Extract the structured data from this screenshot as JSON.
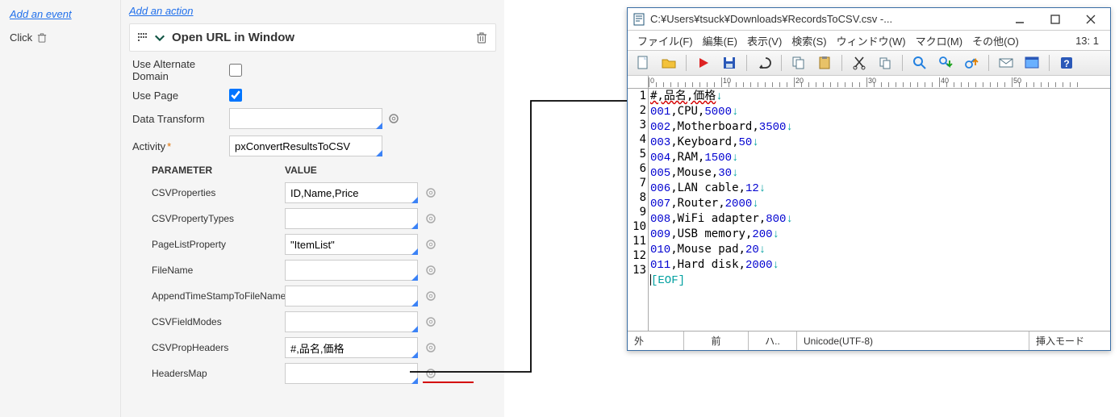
{
  "left_sidebar": {
    "add_event_label": "Add an event",
    "click_label": "Click"
  },
  "form": {
    "add_action_label": "Add an action",
    "action_title": "Open URL in Window",
    "labels": {
      "use_alt_domain": "Use Alternate Domain",
      "use_page": "Use Page",
      "data_transform": "Data Transform",
      "activity": "Activity"
    },
    "checks": {
      "use_alt_domain": false,
      "use_page": true
    },
    "values": {
      "data_transform": "",
      "activity": "pxConvertResultsToCSV"
    },
    "params_header": {
      "parameter": "PARAMETER",
      "value": "VALUE"
    },
    "params": [
      {
        "name": "CSVProperties",
        "value": "ID,Name,Price"
      },
      {
        "name": "CSVPropertyTypes",
        "value": ""
      },
      {
        "name": "PageListProperty",
        "value": "\"ItemList\""
      },
      {
        "name": "FileName",
        "value": ""
      },
      {
        "name": "AppendTimeStampToFileName",
        "value": ""
      },
      {
        "name": "CSVFieldModes",
        "value": ""
      },
      {
        "name": "CSVPropHeaders",
        "value": "#,品名,価格"
      },
      {
        "name": "HeadersMap",
        "value": ""
      }
    ]
  },
  "editor": {
    "title": "C:¥Users¥tsuck¥Downloads¥RecordsToCSV.csv  -...",
    "menus": [
      "ファイル(F)",
      "編集(E)",
      "表示(V)",
      "検索(S)",
      "ウィンドウ(W)",
      "マクロ(M)",
      "その他(O)"
    ],
    "cursor_pos": "13: 1",
    "lines": [
      {
        "n": 1,
        "text": "#,品名,価格",
        "kind": "header"
      },
      {
        "n": 2,
        "a": "001,CPU,",
        "b": "5000"
      },
      {
        "n": 3,
        "a": "002,Motherboard,",
        "b": "3500"
      },
      {
        "n": 4,
        "a": "003,Keyboard,",
        "b": "50"
      },
      {
        "n": 5,
        "a": "004,RAM,",
        "b": "1500"
      },
      {
        "n": 6,
        "a": "005,Mouse,",
        "b": "30"
      },
      {
        "n": 7,
        "a": "006,LAN cable,",
        "b": "12"
      },
      {
        "n": 8,
        "a": "007,Router,",
        "b": "2000"
      },
      {
        "n": 9,
        "a": "008,WiFi adapter,",
        "b": "800"
      },
      {
        "n": 10,
        "a": "009,USB memory,",
        "b": "200"
      },
      {
        "n": 11,
        "a": "010,Mouse pad,",
        "b": "20"
      },
      {
        "n": 12,
        "a": "011,Hard disk,",
        "b": "2000"
      },
      {
        "n": 13,
        "eof": "[EOF]"
      }
    ],
    "ruler_marks": [
      "0",
      "10",
      "20",
      "30",
      "40",
      "50"
    ],
    "status": {
      "c1": "外",
      "c2": "前",
      "c3": "ハ..",
      "c4": "Unicode(UTF-8)",
      "c5": "挿入モード"
    }
  }
}
